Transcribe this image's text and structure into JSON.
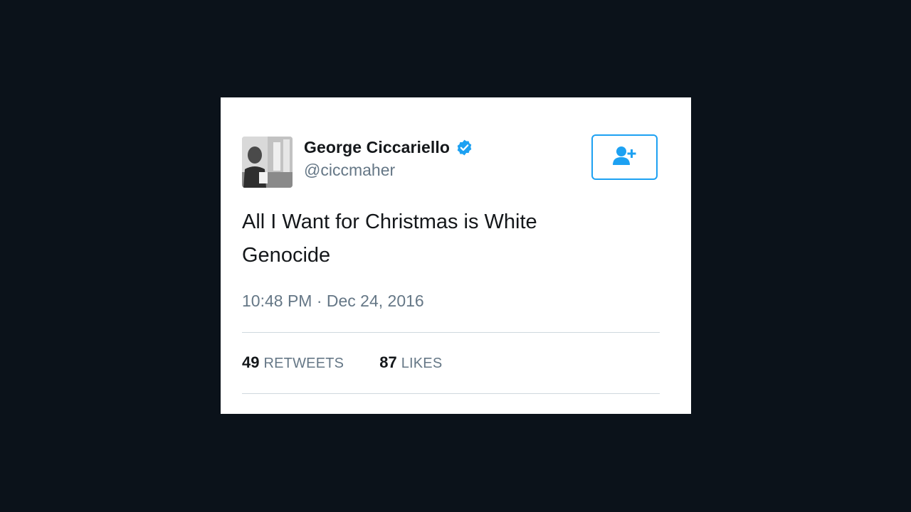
{
  "tweet": {
    "author": {
      "display_name": "George Ciccariello",
      "handle": "@ciccmaher",
      "verified": true,
      "avatar_icon": "user-photo"
    },
    "follow_button": {
      "icon": "add-user-icon",
      "color": "#1da1f2"
    },
    "text_line1": "All I Want for Christmas is White",
    "text_line2": "Genocide",
    "timestamp": "10:48 PM · Dec 24, 2016",
    "stats": {
      "retweets_count": "49",
      "retweets_label": "RETWEETS",
      "likes_count": "87",
      "likes_label": "LIKES"
    }
  },
  "colors": {
    "background": "#0b121a",
    "card": "#ffffff",
    "accent": "#1da1f2",
    "secondary_text": "#657786",
    "primary_text": "#14171a"
  }
}
